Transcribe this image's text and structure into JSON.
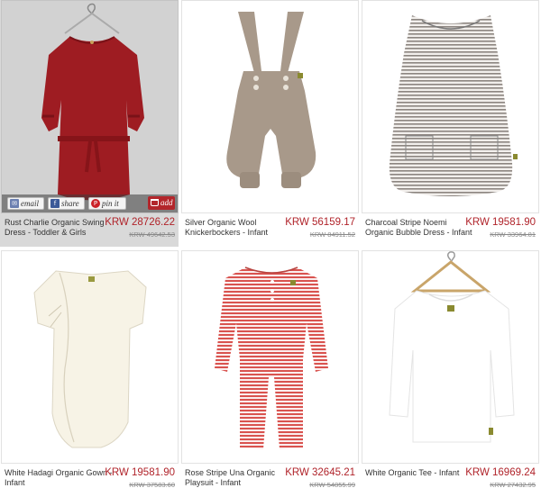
{
  "products": [
    {
      "name": "Rust Charlie Organic Swing Dress - Toddler & Girls",
      "price": "KRW 28726.22",
      "original_price": "KRW 49642.53"
    },
    {
      "name": "Silver Organic Wool Knickerbockers - Infant",
      "price": "KRW 56159.17",
      "original_price": "KRW 84911.52"
    },
    {
      "name": "Charcoal Stripe Noemi Organic Bubble Dress - Infant",
      "price": "KRW 19581.90",
      "original_price": "KRW 33964.81"
    },
    {
      "name": "White Hadagi Organic Gown - Infant",
      "price": "KRW 19581.90",
      "original_price": "KRW 37583.60"
    },
    {
      "name": "Rose Stripe Una Organic Playsuit - Infant",
      "price": "KRW 32645.21",
      "original_price": "KRW 54855.99"
    },
    {
      "name": "White Organic Tee - Infant",
      "price": "KRW 16969.24",
      "original_price": "KRW 27432.95"
    }
  ],
  "share_bar": {
    "email_label": "email",
    "share_label": "share",
    "pin_label": "pin it",
    "add_label": "add"
  },
  "icons": [
    "email-icon",
    "facebook-icon",
    "pinterest-icon",
    "cart-icon",
    "hanger-icon"
  ],
  "colors": {
    "price": "#b0232a",
    "add_button": "#b3262b",
    "dress_red": "#9e1c22",
    "knicker_tan": "#a8998a",
    "stripe_grey": "#8c8580",
    "stripe_rose": "#d9534f"
  }
}
